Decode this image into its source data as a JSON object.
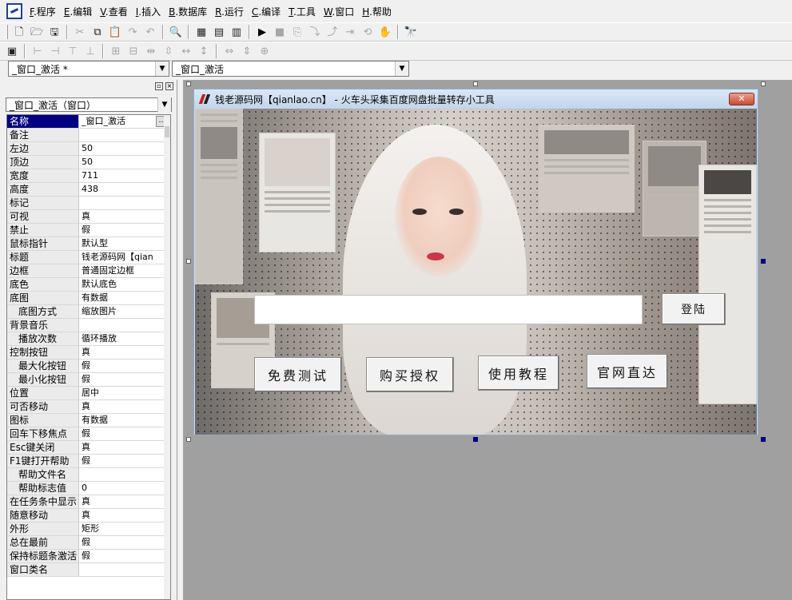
{
  "menubar": {
    "items": [
      {
        "key": "F",
        "label": ".程序"
      },
      {
        "key": "E",
        "label": ".编辑"
      },
      {
        "key": "V",
        "label": ".查看"
      },
      {
        "key": "I",
        "label": ".插入"
      },
      {
        "key": "B",
        "label": ".数据库"
      },
      {
        "key": "R",
        "label": ".运行"
      },
      {
        "key": "C",
        "label": ".编译"
      },
      {
        "key": "T",
        "label": ".工具"
      },
      {
        "key": "W",
        "label": ".窗口"
      },
      {
        "key": "H",
        "label": ".帮助"
      }
    ]
  },
  "combos": {
    "left": "_窗口_激活 *",
    "right": "_窗口_激活",
    "object": "_窗口_激活（窗口）"
  },
  "properties": [
    {
      "name": "名称",
      "value": "_窗口_激活",
      "sub": false
    },
    {
      "name": "备注",
      "value": "",
      "sub": false
    },
    {
      "name": "左边",
      "value": "50",
      "sub": false
    },
    {
      "name": "顶边",
      "value": "50",
      "sub": false
    },
    {
      "name": "宽度",
      "value": "711",
      "sub": false
    },
    {
      "name": "高度",
      "value": "438",
      "sub": false
    },
    {
      "name": "标记",
      "value": "",
      "sub": false
    },
    {
      "name": "可视",
      "value": "真",
      "sub": false
    },
    {
      "name": "禁止",
      "value": "假",
      "sub": false
    },
    {
      "name": "鼠标指针",
      "value": "默认型",
      "sub": false
    },
    {
      "name": "标题",
      "value": "钱老源码网【qian",
      "sub": false
    },
    {
      "name": "边框",
      "value": "普通固定边框",
      "sub": false
    },
    {
      "name": "底色",
      "value": "默认底色",
      "sub": false
    },
    {
      "name": "底图",
      "value": "有数据",
      "sub": false
    },
    {
      "name": "底图方式",
      "value": "缩放图片",
      "sub": true
    },
    {
      "name": "背景音乐",
      "value": "",
      "sub": false
    },
    {
      "name": "播放次数",
      "value": "循环播放",
      "sub": true
    },
    {
      "name": "控制按钮",
      "value": "真",
      "sub": false
    },
    {
      "name": "最大化按钮",
      "value": "假",
      "sub": true
    },
    {
      "name": "最小化按钮",
      "value": "假",
      "sub": true
    },
    {
      "name": "位置",
      "value": "居中",
      "sub": false
    },
    {
      "name": "可否移动",
      "value": "真",
      "sub": false
    },
    {
      "name": "图标",
      "value": "有数据",
      "sub": false
    },
    {
      "name": "回车下移焦点",
      "value": "假",
      "sub": false
    },
    {
      "name": "Esc键关闭",
      "value": "真",
      "sub": false
    },
    {
      "name": "F1键打开帮助",
      "value": "假",
      "sub": false
    },
    {
      "name": "帮助文件名",
      "value": "",
      "sub": true
    },
    {
      "name": "帮助标志值",
      "value": "0",
      "sub": true
    },
    {
      "name": "在任务条中显示",
      "value": "真",
      "sub": false
    },
    {
      "name": "随意移动",
      "value": "真",
      "sub": false
    },
    {
      "name": "外形",
      "value": "矩形",
      "sub": false
    },
    {
      "name": "总在最前",
      "value": "假",
      "sub": false
    },
    {
      "name": "保持标题条激活",
      "value": "假",
      "sub": false
    },
    {
      "name": "窗口类名",
      "value": "",
      "sub": false
    }
  ],
  "form": {
    "title": "钱老源码网【qianlao.cn】 - 火车头采集百度网盘批量转存小工具",
    "close_glyph": "✕",
    "login_label": "登陆",
    "buttons": [
      "免费测试",
      "购买授权",
      "使用教程",
      "官网直达"
    ]
  },
  "icons": {
    "app": "app-logo-icon",
    "ellipsis": "…"
  },
  "colors": {
    "selected_row": "#000080",
    "design_background": "#a0a0a0",
    "form_border": "#8aaed3"
  }
}
